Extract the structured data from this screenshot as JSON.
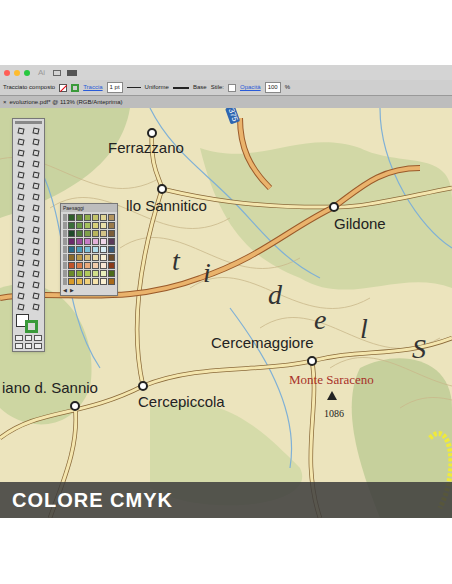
{
  "app_bar": {
    "logo": "Ai"
  },
  "control_bar": {
    "mode": "Tracciato composto",
    "stroke_label": "Traccia",
    "stroke_weight": "1 pt",
    "profile": "Uniforme",
    "brush": "Base",
    "style_label": "Stile:",
    "opacity_label": "Opacità",
    "opacity": "100",
    "percent": "%"
  },
  "document_tab": {
    "close": "×",
    "title": "evoluzione.pdf* @ 113% (RGB/Anteprima)"
  },
  "map": {
    "road_number": "375",
    "places": [
      {
        "name": "Ferrazzano",
        "kind": "town"
      },
      {
        "name": "llo Sannitico",
        "kind": "town"
      },
      {
        "name": "Gildone",
        "kind": "town"
      },
      {
        "name": "Cercemaggiore",
        "kind": "town"
      },
      {
        "name": "Cercepiccola",
        "kind": "town"
      },
      {
        "name": "iano d. Sannio",
        "kind": "town"
      },
      {
        "name": "Monte Saraceno",
        "kind": "peak"
      }
    ],
    "elevation": "1086",
    "region_letters": [
      "t",
      "i",
      "d",
      "e",
      "l",
      "S"
    ]
  },
  "swatch_panel": {
    "title": "Paesaggi",
    "rows": [
      [
        "#2f5e2b",
        "#5a7f34",
        "#8fae4a",
        "#c4c46a",
        "#e0d596",
        "#b3945f"
      ],
      [
        "#3b6e3a",
        "#6b9a45",
        "#a5c05c",
        "#d8d07a",
        "#e9dfa8",
        "#9a7a4a"
      ],
      [
        "#1f4a2a",
        "#4d7a3a",
        "#7fa04a",
        "#b8b45e",
        "#d2c386",
        "#7b5d3a"
      ],
      [
        "#6b2a6b",
        "#9a4a9a",
        "#c67bc6",
        "#e2b0d8",
        "#f0d8ea",
        "#5a3a5a"
      ],
      [
        "#2a6b8a",
        "#4a9ab8",
        "#7ac0d8",
        "#b0dcea",
        "#d8eef5",
        "#3a5a7a"
      ],
      [
        "#8a6a2a",
        "#b89a4a",
        "#d8c07a",
        "#eadcaa",
        "#f5eed2",
        "#6a4a2a"
      ],
      [
        "#c0532a",
        "#d87a4a",
        "#e8a87a",
        "#f2ccaa",
        "#f8e6d2",
        "#8a3a1a"
      ],
      [
        "#6a8a2a",
        "#8aaa3a",
        "#b0c85a",
        "#d0de8a",
        "#e8f0ba",
        "#4a6a1a"
      ],
      [
        "#d89a2a",
        "#e8b84a",
        "#f0d07a",
        "#f5e2aa",
        "#faf0d2",
        "#a86a1a"
      ]
    ],
    "buttons": [
      "◀",
      "▶"
    ]
  },
  "banner": "COLORE CMYK"
}
